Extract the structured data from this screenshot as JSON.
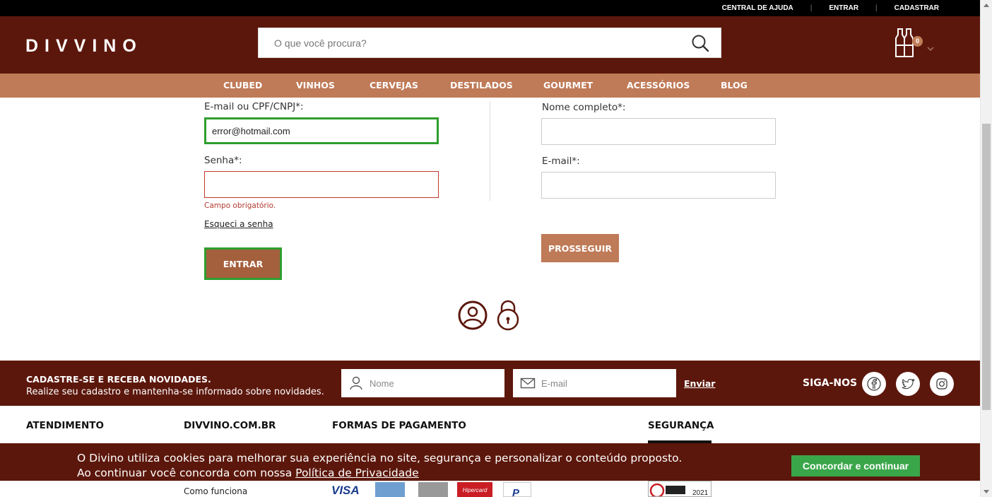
{
  "topbar": {
    "help": "CENTRAL DE AJUDA",
    "login": "ENTRAR",
    "register": "CADASTRAR"
  },
  "header": {
    "logo": "DIVVINO",
    "search_placeholder": "O que você procura?",
    "cart_count": "0"
  },
  "nav": {
    "items": [
      "CLUBED",
      "VINHOS",
      "CERVEJAS",
      "DESTILADOS",
      "GOURMET",
      "ACESSÓRIOS",
      "BLOG"
    ]
  },
  "login": {
    "email_label": "E-mail ou CPF/CNPJ*:",
    "email_value": "error@hotmail.com",
    "password_label": "Senha*:",
    "password_value": "",
    "error": "Campo obrigatório.",
    "forgot": "Esqueci a senha",
    "submit": "ENTRAR"
  },
  "register": {
    "name_label": "Nome completo*:",
    "email_label": "E-mail*:",
    "submit": "PROSSEGUIR"
  },
  "icons": {
    "user": "user-circle-icon",
    "lock": "padlock-icon",
    "search": "search-icon",
    "cart": "wine-bottles-cart-icon"
  },
  "newsletter": {
    "title": "CADASTRE-SE E RECEBA NOVIDADES.",
    "subtitle": "Realize seu cadastro e mantenha-se informado sobre novidades.",
    "name_placeholder": "Nome",
    "email_placeholder": "E-mail",
    "send": "Enviar",
    "follow": "SIGA-NOS"
  },
  "footer": {
    "attendance": "ATENDIMENTO",
    "site": "DIVVINO.COM.BR",
    "payment": "FORMAS DE PAGAMENTO",
    "security": "SEGURANÇA",
    "how_it_works": "Como funciona",
    "payment_logos": [
      "VISA",
      "Hipercard"
    ],
    "seal_year": "2021"
  },
  "cookie": {
    "line1": "O Divino utiliza cookies para melhorar sua experiência no site, segurança e personalizar o conteúdo proposto.",
    "line2_prefix": "Ao continuar você concorda com nossa ",
    "link": "Política de Privacidade",
    "button": "Concordar e continuar"
  },
  "colors": {
    "brand_dark": "#5c170c",
    "brand_light": "#bf7a57",
    "success": "#2e9e2e",
    "error": "#b23a2f",
    "cookie_button": "#3aa64a"
  }
}
